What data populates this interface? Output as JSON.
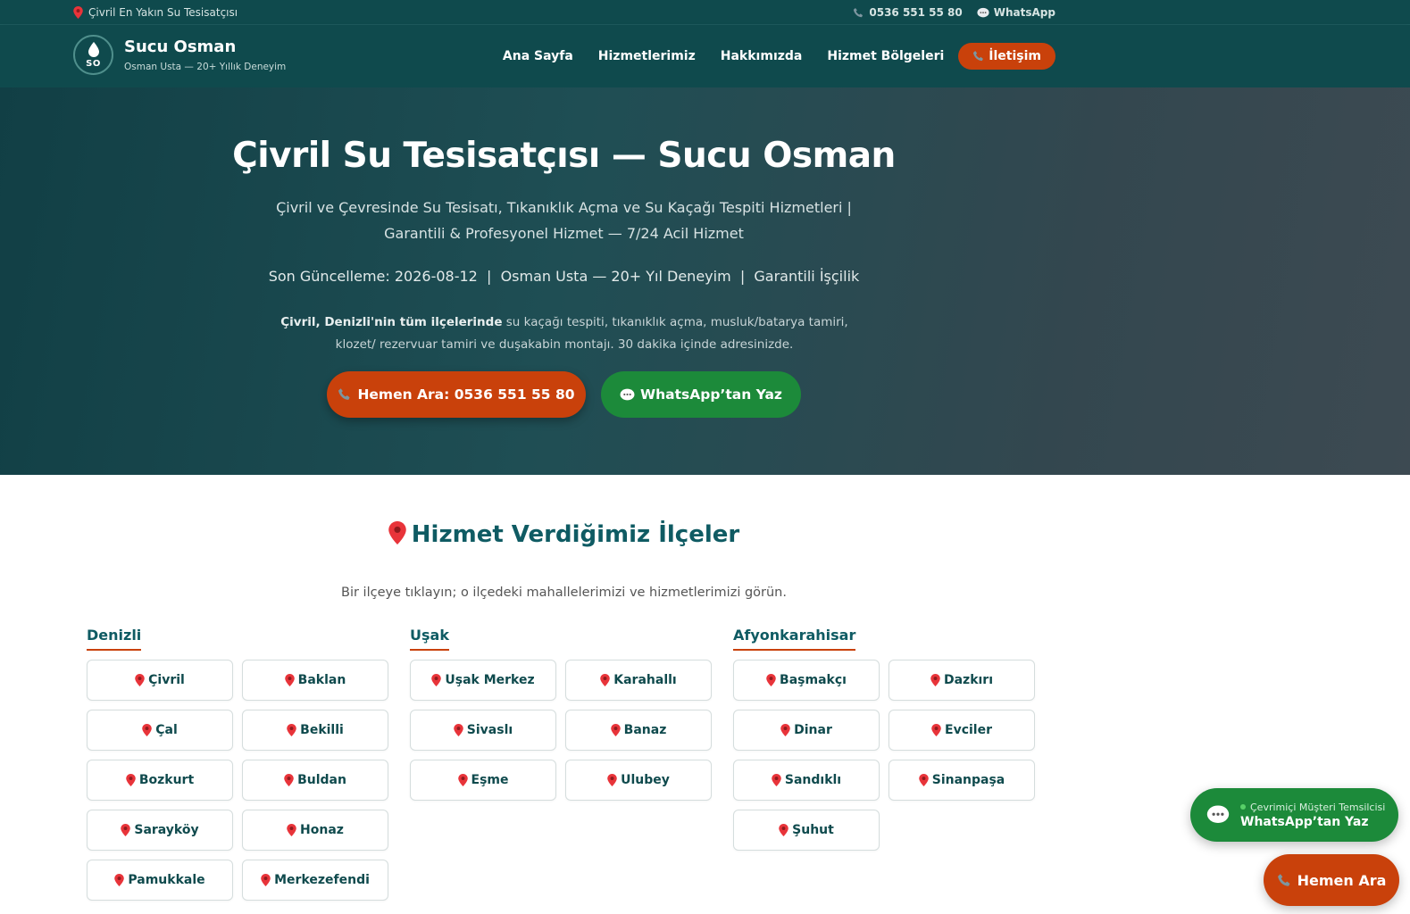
{
  "topbar": {
    "location_text": "Çivril En Yakın Su Tesisatçısı",
    "phone": "0536 551 55 80",
    "whatsapp": "WhatsApp"
  },
  "brand": {
    "name": "Sucu Osman",
    "tagline": "Osman Usta — 20+ Yıllık Deneyim",
    "monogram": "SO"
  },
  "nav": {
    "items": [
      "Ana Sayfa",
      "Hizmetlerimiz",
      "Hakkımızda",
      "Hizmet Bölgeleri"
    ],
    "contact": "İletişim"
  },
  "hero": {
    "title": "Çivril Su Tesisatçısı — Sucu Osman",
    "subtitle": "Çivril ve Çevresinde Su Tesisatı, Tıkanıklık Açma ve Su Kaçağı Tespiti Hizmetleri | Garantili & Profesyonel Hizmet — 7/24 Acil Hizmet",
    "meta": "Son Güncelleme: 2026-08-12  |  Osman Usta — 20+ Yıl Deneyim  |  Garantili İşçilik",
    "desc_bold": "Çivril, Denizli'nin tüm ilçelerinde",
    "desc_rest": " su kaçağı tespiti, tıkanıklık açma, musluk/batarya tamiri, klozet/ rezervuar tamiri ve duşakabin montajı. 30 dakika içinde adresinizde.",
    "call_button": "Hemen Ara: 0536 551 55 80",
    "whatsapp_button": "WhatsApp’tan Yaz"
  },
  "districts": {
    "title": "Hizmet Verdiğimiz İlçeler",
    "subtitle": "Bir ilçeye tıklayın; o ilçedeki mahallelerimizi ve hizmetlerimizi görün.",
    "regions": [
      {
        "name": "Denizli",
        "items": [
          "Çivril",
          "Baklan",
          "Çal",
          "Bekilli",
          "Bozkurt",
          "Buldan",
          "Sarayköy",
          "Honaz",
          "Pamukkale",
          "Merkezefendi"
        ]
      },
      {
        "name": "Uşak",
        "items": [
          "Uşak Merkez",
          "Karahallı",
          "Sivaslı",
          "Banaz",
          "Eşme",
          "Ulubey"
        ]
      },
      {
        "name": "Afyonkarahisar",
        "items": [
          "Başmakçı",
          "Dazkırı",
          "Dinar",
          "Evciler",
          "Sandıklı",
          "Sinanpaşa",
          "Şuhut"
        ]
      }
    ]
  },
  "float": {
    "online_label": "Çevrimiçi Müşteri Temsilcisi",
    "whatsapp_label": "WhatsApp’tan Yaz",
    "call_label": "Hemen Ara"
  },
  "colors": {
    "header_bg": "#0f4a4d",
    "accent_orange": "#c9410b",
    "whatsapp_green": "#1c8a3a",
    "heading_teal": "#0f5b63"
  }
}
